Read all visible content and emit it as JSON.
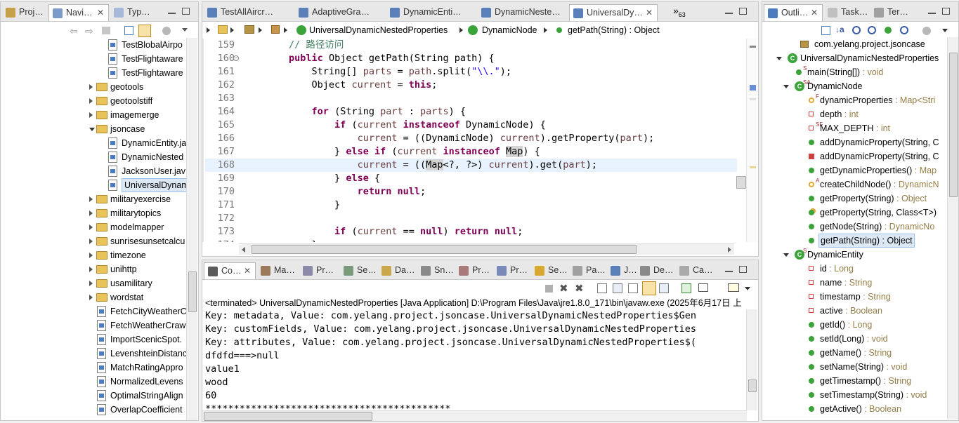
{
  "left_pane": {
    "tabs": [
      {
        "label": "Proj…",
        "active": false
      },
      {
        "label": "Navi…",
        "active": true
      },
      {
        "label": "Typ…",
        "active": false
      }
    ],
    "tree": [
      {
        "type": "file",
        "indent": 2,
        "label": "TestBlobalAirpo"
      },
      {
        "type": "file",
        "indent": 2,
        "label": "TestFlightaware"
      },
      {
        "type": "file",
        "indent": 2,
        "label": "TestFlightaware"
      },
      {
        "type": "folder",
        "indent": 1,
        "open": false,
        "label": "geotools"
      },
      {
        "type": "folder",
        "indent": 1,
        "open": false,
        "label": "geotoolstiff"
      },
      {
        "type": "folder",
        "indent": 1,
        "open": false,
        "label": "imagemerge"
      },
      {
        "type": "folder",
        "indent": 1,
        "open": true,
        "label": "jsoncase"
      },
      {
        "type": "file",
        "indent": 2,
        "label": "DynamicEntity.ja"
      },
      {
        "type": "file",
        "indent": 2,
        "label": "DynamicNested"
      },
      {
        "type": "file",
        "indent": 2,
        "label": "JacksonUser.jav"
      },
      {
        "type": "file",
        "indent": 2,
        "label": "UniversalDynam",
        "selected": true
      },
      {
        "type": "folder",
        "indent": 1,
        "open": false,
        "label": "militaryexercise"
      },
      {
        "type": "folder",
        "indent": 1,
        "open": false,
        "label": "militarytopics"
      },
      {
        "type": "folder",
        "indent": 1,
        "open": false,
        "label": "modelmapper"
      },
      {
        "type": "folder",
        "indent": 1,
        "open": false,
        "label": "sunrisesunsetcalcu"
      },
      {
        "type": "folder",
        "indent": 1,
        "open": false,
        "label": "timezone"
      },
      {
        "type": "folder",
        "indent": 1,
        "open": false,
        "label": "unihttp"
      },
      {
        "type": "folder",
        "indent": 1,
        "open": false,
        "label": "usamilitary"
      },
      {
        "type": "folder",
        "indent": 1,
        "open": false,
        "label": "wordstat"
      },
      {
        "type": "file",
        "indent": 1,
        "label": "FetchCityWeatherC"
      },
      {
        "type": "file",
        "indent": 1,
        "label": "FetchWeatherCraw"
      },
      {
        "type": "file",
        "indent": 1,
        "label": "ImportScenicSpot."
      },
      {
        "type": "file",
        "indent": 1,
        "label": "LevenshteinDistanc"
      },
      {
        "type": "file",
        "indent": 1,
        "label": "MatchRatingAppro"
      },
      {
        "type": "file",
        "indent": 1,
        "label": "NormalizedLevens"
      },
      {
        "type": "file",
        "indent": 1,
        "label": "OptimalStringAlign"
      },
      {
        "type": "file",
        "indent": 1,
        "label": "OverlapCoefficient"
      }
    ]
  },
  "editor": {
    "tabs": [
      {
        "label": "TestAllAircr…",
        "active": false
      },
      {
        "label": "AdaptiveGra…",
        "active": false
      },
      {
        "label": "DynamicEnti…",
        "active": false
      },
      {
        "label": "DynamicNeste…",
        "active": false
      },
      {
        "label": "UniversalDy…",
        "active": true
      }
    ],
    "overflow_label": "»",
    "overflow_count": "63",
    "breadcrumb": [
      "UniversalDynamicNestedProperties",
      "DynamicNode",
      "getPath(String) : Object"
    ],
    "lines": [
      {
        "n": "159",
        "html": "        <span class='cm'>// 路径访问</span>"
      },
      {
        "n": "160",
        "html": "        <span class='kw'>public</span> Object getPath(String path) {"
      },
      {
        "n": "161",
        "html": "            String[] <span class='fld'>parts</span> = <span class='fld'>path</span>.split(<span class='str'>\"\\\\.\"</span>);"
      },
      {
        "n": "162",
        "html": "            Object <span class='fld'>current</span> = <span class='kw'>this</span>;"
      },
      {
        "n": "163",
        "html": ""
      },
      {
        "n": "164",
        "html": "            <span class='kw'>for</span> (String <span class='fld'>part</span> : <span class='fld'>parts</span>) {"
      },
      {
        "n": "165",
        "html": "                <span class='kw'>if</span> (<span class='fld'>current</span> <span class='kw'>instanceof</span> DynamicNode) {"
      },
      {
        "n": "166",
        "html": "                    <span class='fld'>current</span> = ((DynamicNode) <span class='fld'>current</span>).getProperty(<span class='fld'>part</span>);"
      },
      {
        "n": "167",
        "html": "                } <span class='kw'>else</span> <span class='kw'>if</span> (<span class='fld'>current</span> <span class='kw'>instanceof</span> <span style='background:#d4d4d4'>Map</span>) {"
      },
      {
        "n": "168",
        "html": "                    <span class='fld'>current</span> = ((<span style='background:#d4d4d4'>Map</span>&lt;?, ?&gt;) <span class='fld'>current</span>).get(<span class='fld'>part</span>);",
        "highlight": true
      },
      {
        "n": "169",
        "html": "                } <span class='kw'>else</span> {"
      },
      {
        "n": "170",
        "html": "                    <span class='kw'>return</span> <span class='kw'>null</span>;"
      },
      {
        "n": "171",
        "html": "                }"
      },
      {
        "n": "172",
        "html": ""
      },
      {
        "n": "173",
        "html": "                <span class='kw'>if</span> (<span class='fld'>current</span> == <span class='kw'>null</span>) <span class='kw'>return</span> <span class='kw'>null</span>;"
      },
      {
        "n": "174",
        "html": "            }"
      }
    ]
  },
  "console": {
    "tabs": [
      {
        "label": "Co…",
        "active": true
      },
      {
        "label": "Ma…"
      },
      {
        "label": "Pr…"
      },
      {
        "label": "Se…"
      },
      {
        "label": "Da…"
      },
      {
        "label": "Sn…"
      },
      {
        "label": "Pr…"
      },
      {
        "label": "Pr…"
      },
      {
        "label": "Se…"
      },
      {
        "label": "Pa…"
      },
      {
        "label": "J…"
      },
      {
        "label": "De…"
      },
      {
        "label": "Ca…"
      }
    ],
    "status": "<terminated> UniversalDynamicNestedProperties [Java Application] D:\\Program Files\\Java\\jre1.8.0_171\\bin\\javaw.exe (2025年6月17日 上",
    "lines": [
      "Key: metadata, Value: com.yelang.project.jsoncase.UniversalDynamicNestedProperties$Gen",
      "Key: customFields, Value: com.yelang.project.jsoncase.UniversalDynamicNestedProperties",
      "Key: attributes, Value: com.yelang.project.jsoncase.UniversalDynamicNestedProperties$(",
      "dfdfd===>null",
      "value1",
      "wood",
      "60",
      "*******************************************"
    ]
  },
  "outline": {
    "tabs": [
      {
        "label": "Outli…",
        "active": true
      },
      {
        "label": "Task…"
      },
      {
        "label": "Ter…"
      }
    ],
    "rows": [
      {
        "indent": 0,
        "kind": "package",
        "label": "com.yelang.project.jsoncase",
        "type": ""
      },
      {
        "indent": 0,
        "kind": "class",
        "twisty": "open",
        "label": "UniversalDynamicNestedProperties",
        "type": ""
      },
      {
        "indent": 1,
        "kind": "method-public",
        "decor": "S",
        "label": "main(String[])",
        "type": " : void"
      },
      {
        "indent": 1,
        "kind": "class",
        "twisty": "open",
        "decor": "SA",
        "label": "DynamicNode",
        "type": ""
      },
      {
        "indent": 2,
        "kind": "field-protected",
        "decor": "F",
        "label": "dynamicProperties",
        "type": " : Map<Stri"
      },
      {
        "indent": 2,
        "kind": "field-private",
        "label": "depth",
        "type": " : int"
      },
      {
        "indent": 2,
        "kind": "field-private",
        "decor": "SF",
        "label": "MAX_DEPTH",
        "type": " : int"
      },
      {
        "indent": 2,
        "kind": "method-public",
        "label": "addDynamicProperty(String, C",
        "type": ""
      },
      {
        "indent": 2,
        "kind": "method-private",
        "label": "addDynamicProperty(String, C",
        "type": ""
      },
      {
        "indent": 2,
        "kind": "method-public",
        "label": "getDynamicProperties()",
        "type": " : Map"
      },
      {
        "indent": 2,
        "kind": "method-protected",
        "decor": "A",
        "label": "createChildNode()",
        "type": " : DynamicN"
      },
      {
        "indent": 2,
        "kind": "method-public",
        "label": "getProperty(String)",
        "type": " : Object"
      },
      {
        "indent": 2,
        "kind": "method-generic",
        "label": "getProperty(String, Class<T>)",
        "type": ""
      },
      {
        "indent": 2,
        "kind": "method-public",
        "label": "getNode(String)",
        "type": " : DynamicNo"
      },
      {
        "indent": 2,
        "kind": "method-public",
        "label": "getPath(String) : Object",
        "type": "",
        "selected": true
      },
      {
        "indent": 1,
        "kind": "class",
        "twisty": "open",
        "decor": "S",
        "label": "DynamicEntity",
        "type": ""
      },
      {
        "indent": 2,
        "kind": "field-private",
        "label": "id",
        "type": " : Long"
      },
      {
        "indent": 2,
        "kind": "field-private",
        "label": "name",
        "type": " : String"
      },
      {
        "indent": 2,
        "kind": "field-private",
        "label": "timestamp",
        "type": " : String"
      },
      {
        "indent": 2,
        "kind": "field-private",
        "label": "active",
        "type": " : Boolean"
      },
      {
        "indent": 2,
        "kind": "method-public",
        "label": "getId()",
        "type": " : Long"
      },
      {
        "indent": 2,
        "kind": "method-public",
        "label": "setId(Long)",
        "type": " : void"
      },
      {
        "indent": 2,
        "kind": "method-public",
        "label": "getName()",
        "type": " : String"
      },
      {
        "indent": 2,
        "kind": "method-public",
        "label": "setName(String)",
        "type": " : void"
      },
      {
        "indent": 2,
        "kind": "method-public",
        "label": "getTimestamp()",
        "type": " : String"
      },
      {
        "indent": 2,
        "kind": "method-public",
        "label": "setTimestamp(String)",
        "type": " : void"
      },
      {
        "indent": 2,
        "kind": "method-public",
        "label": "getActive()",
        "type": " : Boolean"
      }
    ]
  },
  "colors": {
    "keyword": "#7f0055",
    "comment": "#3f7f5f",
    "string": "#2a00ff",
    "field": "#6a3e3e",
    "method_public": "#3aa33a",
    "field_private": "#d04040",
    "selection": "#dde8f5"
  }
}
